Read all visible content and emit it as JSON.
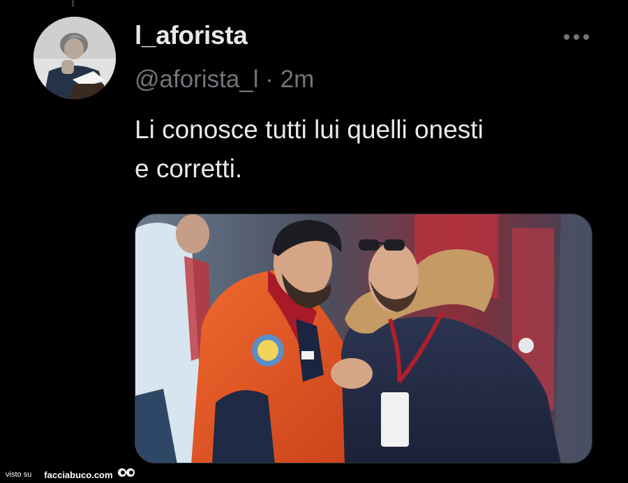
{
  "tweet": {
    "display_name": "l_aforista",
    "handle": "@aforista_l",
    "separator": "·",
    "time": "2m",
    "text": "Li conosce tutti lui quelli onesti\ne corretti.",
    "avatar_icon": "author-avatar",
    "more_icon": "more-horizontal-icon",
    "media_icon": "photo-two-men-greeting"
  },
  "watermark": {
    "prefix": "visto su",
    "site": "facciabuco.com",
    "icon": "eyes-icon"
  },
  "colors": {
    "background": "#000000",
    "text_primary": "#e7e9ea",
    "text_secondary": "#71767b",
    "accent_jacket": "#e8541f",
    "accent_scarf": "#c0142a"
  }
}
